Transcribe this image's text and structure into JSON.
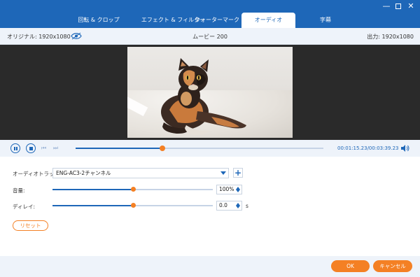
{
  "window": {
    "minimize_glyph": "—",
    "close_glyph": "✕"
  },
  "tabs": [
    {
      "label": "回転 & クロップ"
    },
    {
      "label": "エフェクト & フィルター"
    },
    {
      "label": "ウォーターマーク"
    },
    {
      "label": "オーディオ",
      "active": true
    },
    {
      "label": "字幕"
    }
  ],
  "infobar": {
    "original": "オリジナル: 1920x1080",
    "title": "ムービー 200",
    "output": "出力: 1920x1080"
  },
  "player": {
    "progress": 0.35,
    "time": "00:01:15.23/00:03:39.23",
    "prev_glyph": "⏮",
    "next_glyph": "⏭"
  },
  "audio": {
    "track_label": "オーディオトラック:",
    "track_value": "ENG-AC3-2チャンネル",
    "add_glyph": "+",
    "volume_label": "音量:",
    "volume_value": "100%",
    "volume_level": 0.5,
    "delay_label": "ディレイ:",
    "delay_value": "0.0",
    "delay_level": 0.5,
    "delay_unit": "s",
    "reset_label": "リセット"
  },
  "footer": {
    "ok_label": "OK",
    "cancel_label": "キャンセル"
  },
  "colors": {
    "brand_blue": "#1e67b8",
    "accent_orange": "#f48024",
    "panel_bg": "#eef3fa"
  }
}
